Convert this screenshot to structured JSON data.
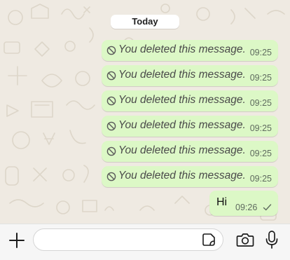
{
  "chat": {
    "date_label": "Today",
    "messages": [
      {
        "type": "deleted",
        "text": "You deleted this message.",
        "time": "09:25"
      },
      {
        "type": "deleted",
        "text": "You deleted this message.",
        "time": "09:25"
      },
      {
        "type": "deleted",
        "text": "You deleted this message.",
        "time": "09:25"
      },
      {
        "type": "deleted",
        "text": "You deleted this message.",
        "time": "09:25"
      },
      {
        "type": "deleted",
        "text": "You deleted this message.",
        "time": "09:25"
      },
      {
        "type": "deleted",
        "text": "You deleted this message.",
        "time": "09:25"
      },
      {
        "type": "text",
        "text": "Hi",
        "time": "09:26",
        "status_icon": "single-check-icon"
      }
    ]
  },
  "input_bar": {
    "input_value": "",
    "placeholder": "",
    "icons": [
      "plus-icon",
      "sticker-icon",
      "camera-icon",
      "microphone-icon"
    ]
  },
  "colors": {
    "outgoing_bubble": "#dcf8c6",
    "chat_background": "#efeae2",
    "input_bar_background": "#f6f6f6",
    "icon_color": "#1c1c1c"
  }
}
